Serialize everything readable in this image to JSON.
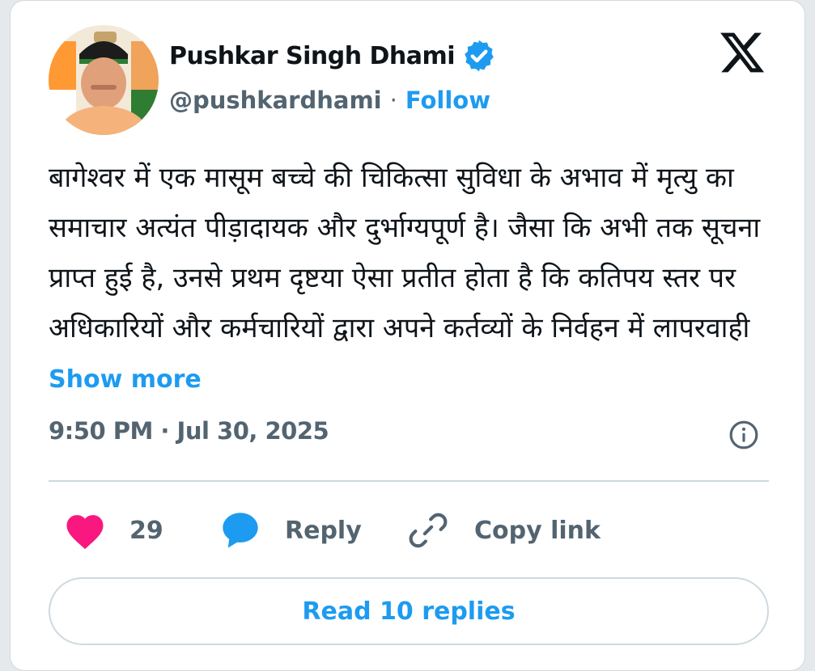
{
  "author": {
    "name": "Pushkar Singh Dhami",
    "handle": "@pushkardhami",
    "separator": "·",
    "follow_label": "Follow"
  },
  "tweet": {
    "text": "बागेश्वर में एक मासूम बच्चे की चिकित्सा सुविधा के अभाव में मृत्यु का समाचार अत्यंत पीड़ादायक और दुर्भाग्यपूर्ण है। जैसा कि अभी तक सूचना प्राप्त हुई है, उनसे प्रथम दृष्टया ऐसा प्रतीत होता है कि कतिपय स्तर पर अधिकारियों और कर्मचारियों द्वारा अपने कर्तव्यों के निर्वहन में लापरवाही",
    "show_more_label": "Show more",
    "timestamp": "9:50 PM · Jul 30, 2025"
  },
  "actions": {
    "like_count": "29",
    "reply_label": "Reply",
    "copy_link_label": "Copy link"
  },
  "read_replies_label": "Read 10 replies",
  "icons": {
    "brand": "x-logo-icon",
    "verified": "verified-badge-icon",
    "info": "info-icon",
    "like": "heart-icon",
    "reply": "speech-bubble-icon",
    "copy": "link-icon"
  },
  "colors": {
    "accent": "#1d9bf0",
    "like": "#f91880",
    "text": "#0f1419",
    "muted": "#536471",
    "border": "#cfd9de"
  }
}
